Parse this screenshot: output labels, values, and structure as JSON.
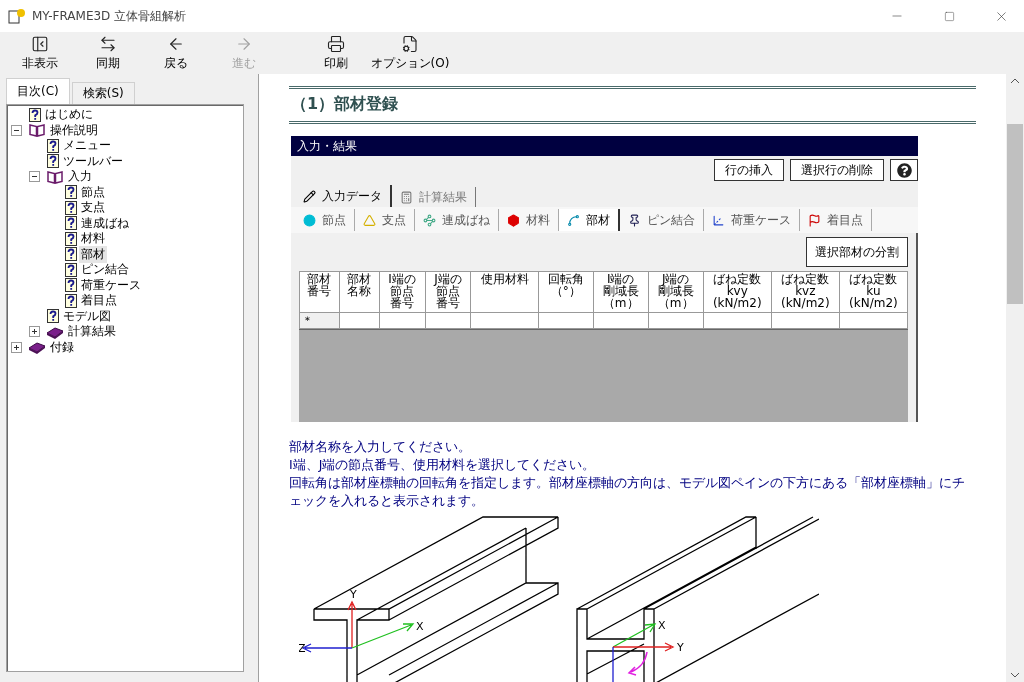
{
  "window": {
    "title": "MY-FRAME3D 立体骨組解析"
  },
  "toolbar": [
    {
      "label": "非表示",
      "disabled": false
    },
    {
      "label": "同期",
      "disabled": false
    },
    {
      "label": "戻る",
      "disabled": false
    },
    {
      "label": "進む",
      "disabled": true
    },
    {
      "label": "印刷",
      "disabled": false
    },
    {
      "label": "オプション(O)",
      "disabled": false
    }
  ],
  "nav_tabs": [
    {
      "label": "目次(C)",
      "selected": true
    },
    {
      "label": "検索(S)",
      "selected": false
    }
  ],
  "tree": [
    {
      "label": "はじめに",
      "kind": "page",
      "selected": false
    },
    {
      "label": "操作説明",
      "kind": "book",
      "expanded": true,
      "selected": false,
      "children": [
        {
          "label": "メニュー",
          "kind": "page",
          "selected": false
        },
        {
          "label": "ツールバー",
          "kind": "page",
          "selected": false
        },
        {
          "label": "入力",
          "kind": "book",
          "expanded": true,
          "selected": false,
          "children": [
            {
              "label": "節点",
              "kind": "page",
              "selected": false
            },
            {
              "label": "支点",
              "kind": "page",
              "selected": false
            },
            {
              "label": "連成ばね",
              "kind": "page",
              "selected": false
            },
            {
              "label": "材料",
              "kind": "page",
              "selected": false
            },
            {
              "label": "部材",
              "kind": "page",
              "selected": true
            },
            {
              "label": "ピン結合",
              "kind": "page",
              "selected": false
            },
            {
              "label": "荷重ケース",
              "kind": "page",
              "selected": false
            },
            {
              "label": "着目点",
              "kind": "page",
              "selected": false
            }
          ]
        },
        {
          "label": "モデル図",
          "kind": "page",
          "selected": false
        },
        {
          "label": "計算結果",
          "kind": "book",
          "expanded": false,
          "selected": false
        }
      ]
    },
    {
      "label": "付録",
      "kind": "book",
      "expanded": false,
      "selected": false
    }
  ],
  "content": {
    "heading": "（1）部材登録",
    "app": {
      "title": "入力・結果",
      "buttons": [
        "行の挿入",
        "選択行の削除"
      ],
      "tabs": [
        {
          "label": "入力データ",
          "selected": true
        },
        {
          "label": "計算結果",
          "selected": false
        }
      ],
      "subtabs": [
        {
          "label": "節点",
          "selected": false
        },
        {
          "label": "支点",
          "selected": false
        },
        {
          "label": "連成ばね",
          "selected": false
        },
        {
          "label": "材料",
          "selected": false
        },
        {
          "label": "部材",
          "selected": true
        },
        {
          "label": "ピン結合",
          "selected": false
        },
        {
          "label": "荷重ケース",
          "selected": false
        },
        {
          "label": "着目点",
          "selected": false
        }
      ],
      "split_button": "選択部材の分割",
      "columns": [
        "部材番号",
        "部材名称",
        "I端の節点番号",
        "J端の節点番号",
        "使用材料",
        "回転角（°）",
        "I端の剛域長（m）",
        "J端の剛域長（m）",
        "ばね定数\nkvy\n(kN/m2)",
        "ばね定数\nkvz\n(kN/m2)",
        "ばね定数\nku\n(kN/m2)"
      ],
      "rows": [
        {
          "marker": "＊"
        }
      ]
    },
    "paragraphs": [
      "部材名称を入力してください。",
      "I端、J端の節点番号、使用材料を選択してください。",
      "回転角は部材座標軸の回転角を指定します。部材座標軸の方向は、モデル図ペインの下方にある「部材座標軸」にチェックを入れると表示されます。"
    ],
    "figure": {
      "i_beam_labels": [
        "Y",
        "X",
        "Z"
      ],
      "channel_labels": [
        "X",
        "Y"
      ]
    }
  }
}
